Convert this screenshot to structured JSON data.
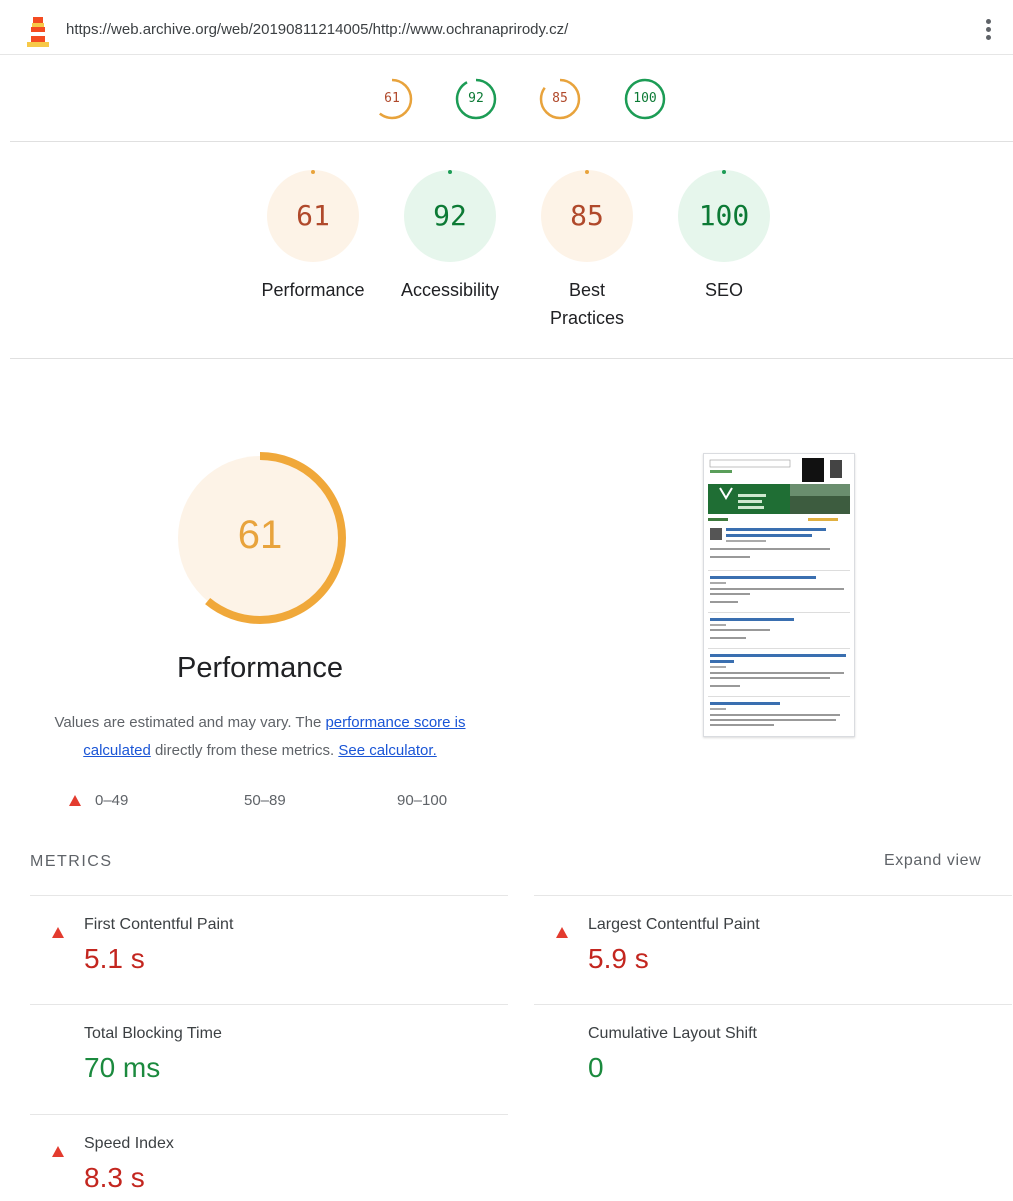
{
  "header": {
    "url": "https://web.archive.org/web/20190811214005/http://www.ochranaprirody.cz/",
    "logo_icon": "lighthouse-icon",
    "menu_icon": "kebab-menu-icon"
  },
  "colors": {
    "average": "#e8a33c",
    "average_bg": "#fdf3e7",
    "pass": "#1c9c55",
    "pass_bg": "#e6f6ec",
    "fail": "#c3261f",
    "link": "#1a55d6"
  },
  "categories": [
    {
      "label": "Performance",
      "score": "61",
      "rating": "average"
    },
    {
      "label": "Accessibility",
      "score": "92",
      "rating": "pass"
    },
    {
      "label": "Best Practices",
      "score": "85",
      "rating": "average"
    },
    {
      "label": "SEO",
      "score": "100",
      "rating": "pass"
    }
  ],
  "performance": {
    "score": "61",
    "title": "Performance",
    "desc_prefix": "Values are estimated and may vary. The ",
    "desc_link": "performance score is calculated",
    "desc_middle": " directly from these metrics. ",
    "desc_link2": "See calculator.",
    "legend": [
      "0–49",
      "50–89",
      "90–100"
    ]
  },
  "metrics": {
    "heading": "METRICS",
    "expand": "Expand view",
    "items": [
      {
        "title": "First Contentful Paint",
        "value": "5.1 s",
        "rating": "fail"
      },
      {
        "title": "Largest Contentful Paint",
        "value": "5.9 s",
        "rating": "fail"
      },
      {
        "title": "Total Blocking Time",
        "value": "70 ms",
        "rating": "pass"
      },
      {
        "title": "Cumulative Layout Shift",
        "value": "0",
        "rating": "pass"
      },
      {
        "title": "Speed Index",
        "value": "8.3 s",
        "rating": "fail"
      }
    ]
  }
}
